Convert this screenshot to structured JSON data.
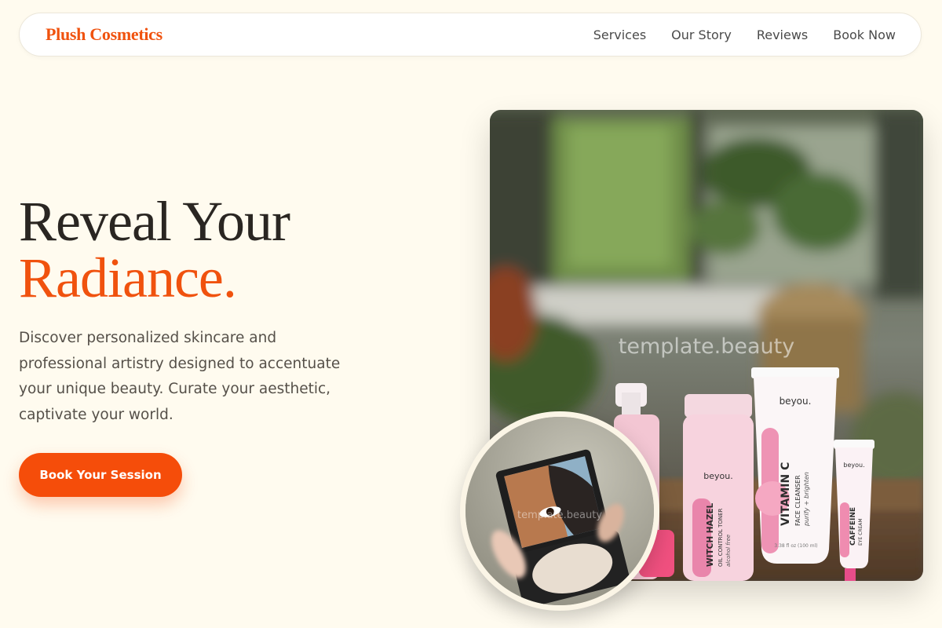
{
  "brand": {
    "name": "Plush Cosmetics",
    "accent": "#f0520e"
  },
  "nav": {
    "links": [
      "Services",
      "Our Story",
      "Reviews",
      "Book Now"
    ]
  },
  "hero": {
    "title_line1": "Reveal Your",
    "title_line2": "Radiance.",
    "description": "Discover personalized skincare and professional artistry designed to accentuate your unique beauty. Curate your aesthetic, captivate your world.",
    "cta_label": "Book Your Session"
  },
  "image": {
    "watermark": "template.beauty",
    "products": {
      "brand": "beyou.",
      "witch_hazel": "WITCH HAZEL",
      "witch_hazel_sub": "OIL CONTROL TONER",
      "witch_hazel_note": "alcohol free",
      "vitamin_c": "VITAMIN C",
      "vitamin_c_sub": "FACE CLEANSER",
      "vitamin_c_note": "purify + brighten",
      "vitamin_c_size": "3.38 fl oz (100 ml)",
      "caffeine": "CAFFEINE",
      "caffeine_sub": "EYE CREAM"
    }
  },
  "inset": {
    "watermark": "template.beauty"
  }
}
